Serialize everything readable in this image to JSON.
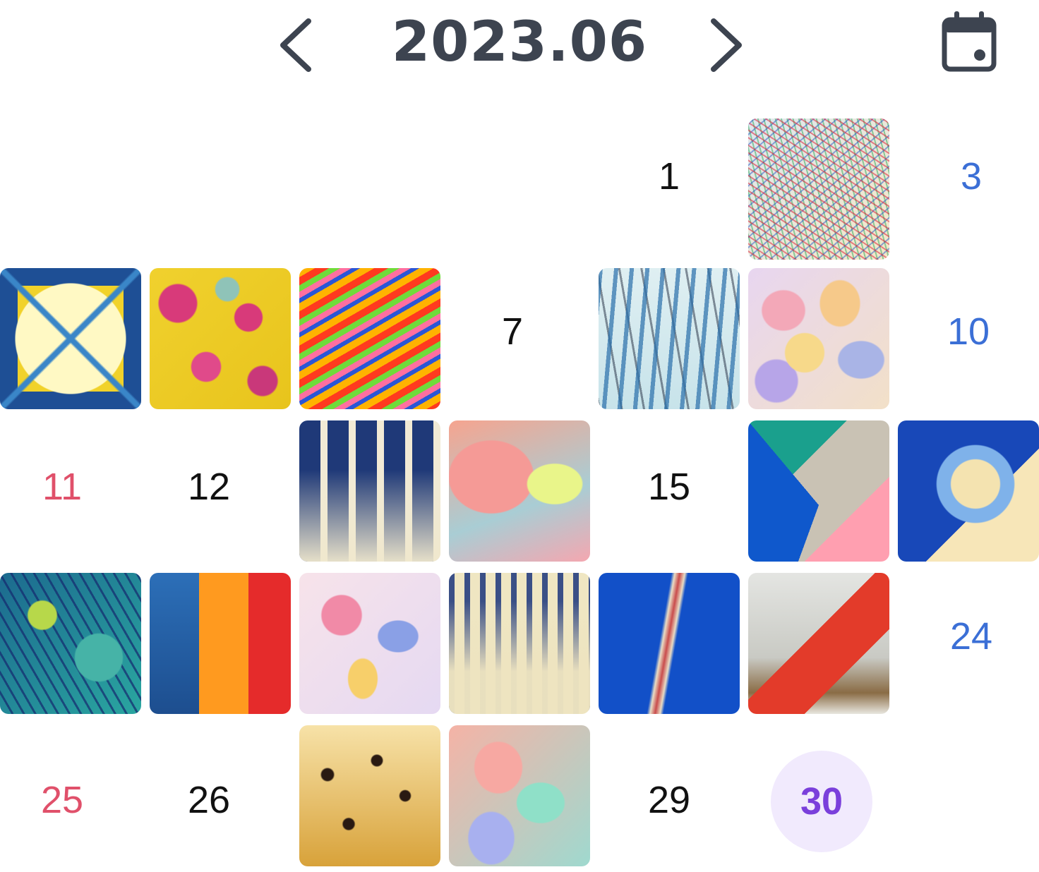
{
  "header": {
    "title": "2023.06",
    "prev_icon": "chevron-left-icon",
    "next_icon": "chevron-right-icon",
    "calendar_icon": "calendar-icon"
  },
  "colors": {
    "title": "#3d4450",
    "saturday": "#3b6fd6",
    "sunday": "#e0506a",
    "today_bg": "#f1eafd",
    "today_text": "#7a3fdb"
  },
  "days": {
    "d1": "1",
    "d3": "3",
    "d7": "7",
    "d10": "10",
    "d11": "11",
    "d12": "12",
    "d15": "15",
    "d24": "24",
    "d25": "25",
    "d26": "26",
    "d29": "29",
    "d30": "30"
  }
}
